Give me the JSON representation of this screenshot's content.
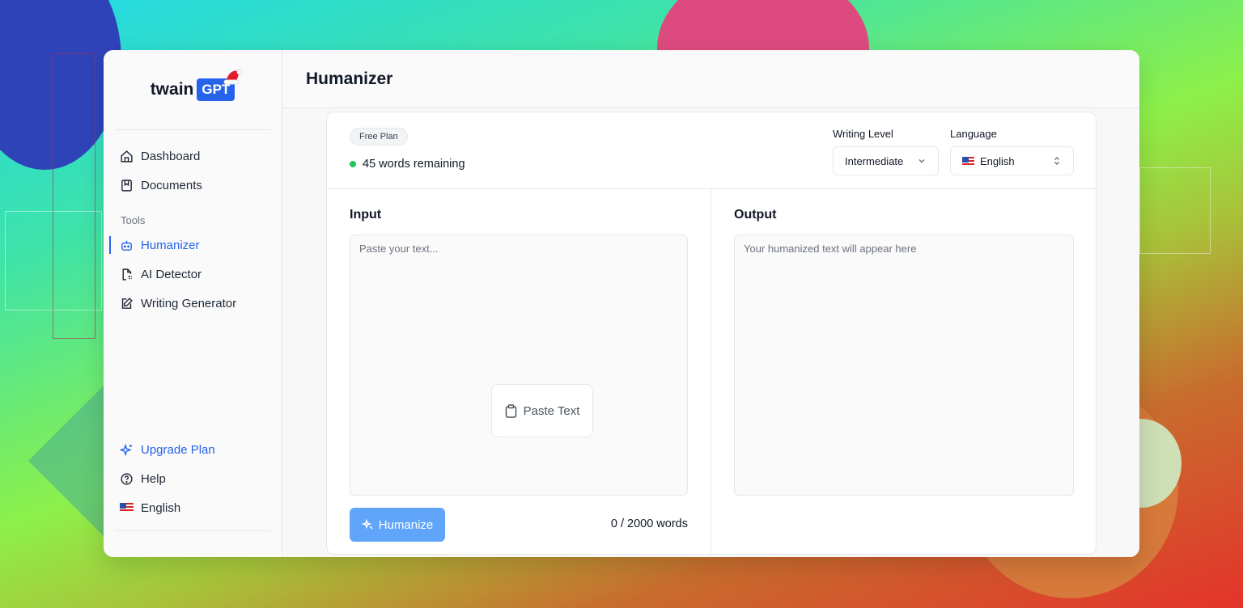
{
  "app": {
    "logo_text": "twain",
    "logo_badge": "GPT"
  },
  "sidebar": {
    "items": [
      {
        "label": "Dashboard",
        "icon": "home-icon"
      },
      {
        "label": "Documents",
        "icon": "document-icon"
      }
    ],
    "section_tools": "Tools",
    "tools": [
      {
        "label": "Humanizer",
        "icon": "robot-icon",
        "active": true
      },
      {
        "label": "AI Detector",
        "icon": "file-scan-icon"
      },
      {
        "label": "Writing Generator",
        "icon": "edit-icon"
      }
    ],
    "bottom": {
      "upgrade": "Upgrade Plan",
      "help": "Help",
      "language": "English"
    }
  },
  "header": {
    "title": "Humanizer"
  },
  "status": {
    "plan": "Free Plan",
    "words_remaining": "45 words remaining"
  },
  "controls": {
    "writing_level_label": "Writing Level",
    "writing_level_value": "Intermediate",
    "language_label": "Language",
    "language_value": "English"
  },
  "input": {
    "title": "Input",
    "placeholder": "Paste your text...",
    "paste_button": "Paste Text",
    "humanize_button": "Humanize",
    "word_count": "0 / 2000 words"
  },
  "output": {
    "title": "Output",
    "placeholder": "Your humanized text will appear here"
  },
  "colors": {
    "accent": "#2563eb",
    "button": "#60a5fa",
    "status_dot": "#22c55e"
  }
}
